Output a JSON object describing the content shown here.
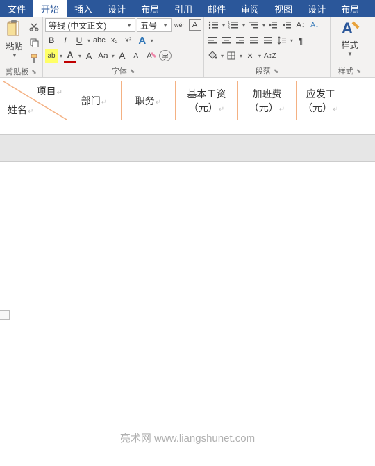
{
  "menu": {
    "tabs": [
      "文件",
      "开始",
      "插入",
      "设计",
      "布局",
      "引用",
      "邮件",
      "审阅",
      "视图",
      "设计",
      "布局"
    ],
    "active": 1
  },
  "clipboard": {
    "label": "剪贴板",
    "paste": "粘贴",
    "cut_icon": "cut",
    "copy_icon": "copy",
    "painter_icon": "format-painter"
  },
  "font": {
    "label": "字体",
    "name": "等线 (中文正文)",
    "size": "五号",
    "bold": "B",
    "italic": "I",
    "underline": "U",
    "strike": "abc",
    "sub": "x₂",
    "sup": "x²",
    "clear": "A",
    "phonetic": "wén",
    "border": "A",
    "effects": "A",
    "highlight": "ab",
    "color": "A",
    "caseAa": "Aa",
    "grow": "A",
    "shrink": "A"
  },
  "para": {
    "label": "段落"
  },
  "styles": {
    "label": "样式",
    "btn": "样式"
  },
  "table": {
    "diag_top": "项目",
    "diag_bottom": "姓名",
    "cols": [
      "部门",
      "职务",
      "基本工资（元）",
      "加班费（元）",
      "应发工（元）"
    ]
  },
  "watermark": {
    "site": "亮术网",
    "url": "www.liangshunet.com"
  }
}
